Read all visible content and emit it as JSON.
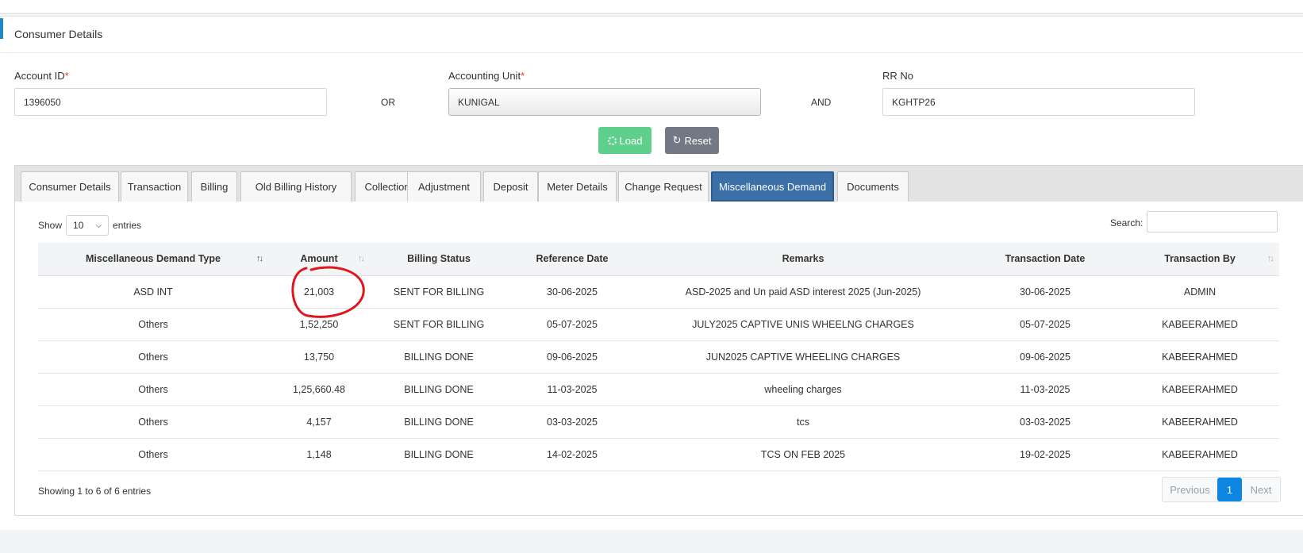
{
  "header": {
    "title": "Consumer Details"
  },
  "form": {
    "account_id": {
      "label": "Account ID",
      "required_mark": "*",
      "value": "1396050"
    },
    "or_label": "OR",
    "accounting_unit": {
      "label": "Accounting Unit",
      "required_mark": "*",
      "value": "KUNIGAL"
    },
    "and_label": "AND",
    "rr_no": {
      "label": "RR No",
      "value": "KGHTP26"
    },
    "load_label": "Load",
    "reset_label": "Reset"
  },
  "tabs": [
    "Consumer Details",
    "Transaction",
    "Billing",
    "Old Billing History",
    "Collection",
    "Adjustment",
    "Deposit",
    "Meter Details",
    "Change Request",
    "Miscellaneous Demand",
    "Documents"
  ],
  "active_tab": "Miscellaneous Demand",
  "table_controls": {
    "show_label": "Show",
    "page_length": "10",
    "entries_label": "entries",
    "search_label": "Search:",
    "search_value": ""
  },
  "table": {
    "columns": [
      "Miscellaneous Demand Type",
      "Amount",
      "Billing Status",
      "Reference Date",
      "Remarks",
      "Transaction Date",
      "Transaction By"
    ],
    "rows": [
      [
        "ASD INT",
        "21,003",
        "SENT FOR BILLING",
        "30-06-2025",
        "ASD-2025 and Un paid ASD interest 2025 (Jun-2025)",
        "30-06-2025",
        "ADMIN"
      ],
      [
        "Others",
        "1,52,250",
        "SENT FOR BILLING",
        "05-07-2025",
        "JULY2025 CAPTIVE UNIS WHEELNG CHARGES",
        "05-07-2025",
        "KABEERAHMED"
      ],
      [
        "Others",
        "13,750",
        "BILLING DONE",
        "09-06-2025",
        "JUN2025 CAPTIVE WHEELING CHARGES",
        "09-06-2025",
        "KABEERAHMED"
      ],
      [
        "Others",
        "1,25,660.48",
        "BILLING DONE",
        "11-03-2025",
        "wheeling charges",
        "11-03-2025",
        "KABEERAHMED"
      ],
      [
        "Others",
        "4,157",
        "BILLING DONE",
        "03-03-2025",
        "tcs",
        "03-03-2025",
        "KABEERAHMED"
      ],
      [
        "Others",
        "1,148",
        "BILLING DONE",
        "14-02-2025",
        "TCS ON FEB 2025",
        "19-02-2025",
        "KABEERAHMED"
      ]
    ]
  },
  "footer": {
    "info": "Showing 1 to 6 of 6 entries",
    "prev_label": "Previous",
    "current_page": "1",
    "next_label": "Next"
  },
  "colors": {
    "accent": "#1e88c7",
    "active_tab": "#3b6fa8",
    "load_button": "#5fcf8c",
    "reset_button": "#727884",
    "annotation": "#e0161f"
  }
}
